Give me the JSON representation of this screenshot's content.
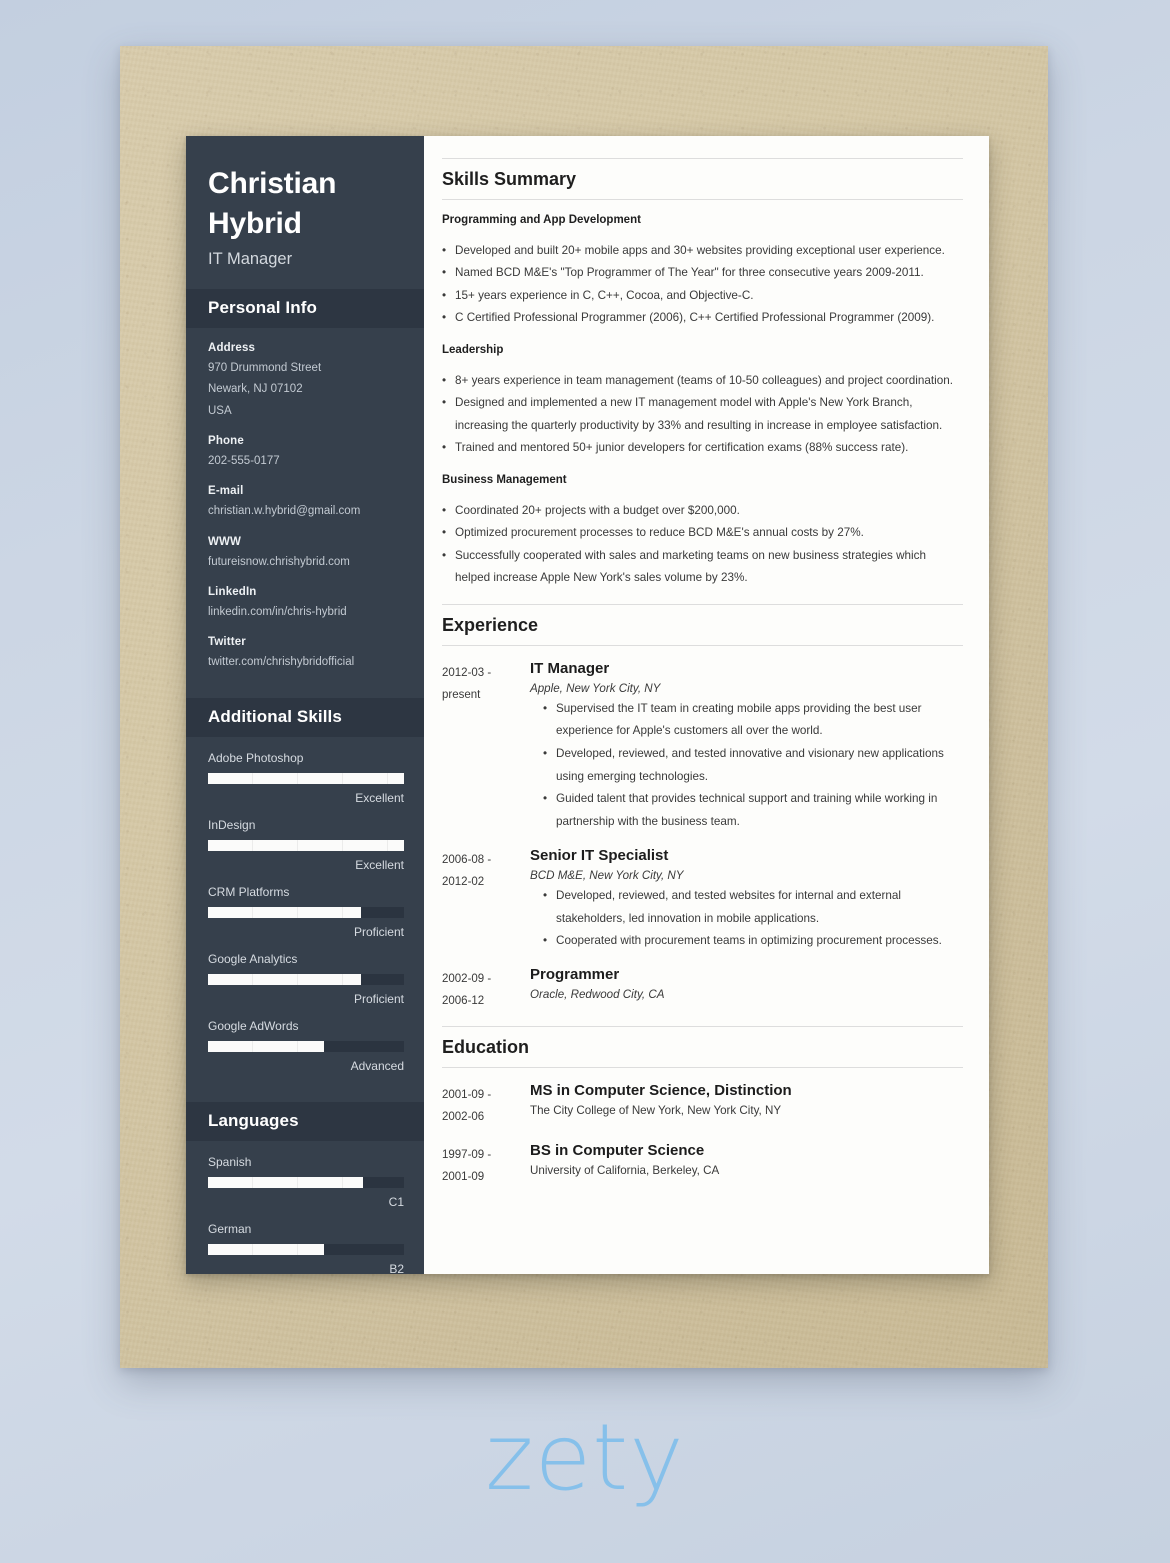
{
  "brand": {
    "wordmark": "zety"
  },
  "header": {
    "name_line1": "Christian",
    "name_line2": "Hybrid",
    "job_title": "IT Manager"
  },
  "sidebar": {
    "personal_info": {
      "section_title": "Personal Info",
      "items": [
        {
          "label": "Address",
          "lines": [
            "970 Drummond Street",
            "Newark, NJ 07102",
            "USA"
          ]
        },
        {
          "label": "Phone",
          "lines": [
            "202-555-0177"
          ]
        },
        {
          "label": "E-mail",
          "lines": [
            "christian.w.hybrid@gmail.com"
          ]
        },
        {
          "label": "WWW",
          "lines": [
            "futureisnow.chrishybrid.com"
          ]
        },
        {
          "label": "LinkedIn",
          "lines": [
            "linkedin.com/in/chris-hybrid"
          ]
        },
        {
          "label": "Twitter",
          "lines": [
            "twitter.com/chrishybridofficial"
          ]
        }
      ]
    },
    "additional_skills": {
      "section_title": "Additional Skills",
      "items": [
        {
          "name": "Adobe Photoshop",
          "level": "Excellent",
          "percent": 100
        },
        {
          "name": "InDesign",
          "level": "Excellent",
          "percent": 100
        },
        {
          "name": "CRM Platforms",
          "level": "Proficient",
          "percent": 78
        },
        {
          "name": "Google Analytics",
          "level": "Proficient",
          "percent": 78
        },
        {
          "name": "Google AdWords",
          "level": "Advanced",
          "percent": 59
        }
      ]
    },
    "languages": {
      "section_title": "Languages",
      "items": [
        {
          "name": "Spanish",
          "level": "C1",
          "percent": 79
        },
        {
          "name": "German",
          "level": "B2",
          "percent": 59
        }
      ]
    }
  },
  "main": {
    "skills_summary": {
      "section_title": "Skills Summary",
      "groups": [
        {
          "heading": "Programming and App Development",
          "bullets": [
            "Developed and built 20+ mobile apps and 30+ websites providing exceptional user experience.",
            "Named BCD M&E's \"Top Programmer of The Year\" for three consecutive years 2009-2011.",
            "15+ years experience in C, C++, Cocoa, and Objective-C.",
            "C Certified Professional Programmer (2006), C++ Certified Professional Programmer (2009)."
          ]
        },
        {
          "heading": "Leadership",
          "bullets": [
            "8+ years experience in team management (teams of 10-50 colleagues) and project coordination.",
            "Designed and implemented a new IT management model with Apple's New York Branch, increasing the quarterly productivity by 33% and resulting in increase in employee satisfaction.",
            "Trained and mentored 50+ junior developers for certification exams (88% success rate)."
          ]
        },
        {
          "heading": "Business Management",
          "bullets": [
            "Coordinated 20+ projects with a budget over $200,000.",
            "Optimized procurement processes to reduce BCD M&E's annual costs by 27%.",
            "Successfully cooperated with sales and marketing teams on new business strategies which helped increase Apple New York's sales volume by 23%."
          ]
        }
      ]
    },
    "experience": {
      "section_title": "Experience",
      "entries": [
        {
          "date_from": "2012-03 -",
          "date_to": "present",
          "title": "IT Manager",
          "org": "Apple, New York City, NY",
          "bullets": [
            "Supervised the IT team in creating mobile apps providing the best user experience for Apple's customers all over the world.",
            "Developed, reviewed, and tested innovative and visionary new applications using emerging technologies.",
            "Guided talent that provides technical support and training while working in partnership with the business team."
          ]
        },
        {
          "date_from": "2006-08 -",
          "date_to": "2012-02",
          "title": "Senior IT Specialist",
          "org": "BCD M&E, New York City, NY",
          "bullets": [
            "Developed, reviewed, and tested websites for internal and external stakeholders, led innovation in mobile applications.",
            "Cooperated with procurement teams in optimizing procurement processes."
          ]
        },
        {
          "date_from": "2002-09 -",
          "date_to": "2006-12",
          "title": "Programmer",
          "org": "Oracle, Redwood City, CA",
          "bullets": []
        }
      ]
    },
    "education": {
      "section_title": "Education",
      "entries": [
        {
          "date_from": "2001-09 -",
          "date_to": "2002-06",
          "title": "MS in Computer Science, Distinction",
          "school": "The City College of New York, New York City, NY"
        },
        {
          "date_from": "1997-09 -",
          "date_to": "2001-09",
          "title": "BS in Computer Science",
          "school": "University of California, Berkeley, CA"
        }
      ]
    }
  },
  "colors": {
    "sidebar_bg": "#36404c",
    "sidebar_header_bg": "#2d3642",
    "paper_bg": "#fdfdfb",
    "board_bg": "#d5c8a6",
    "brand_blue": "#86c0ea"
  }
}
